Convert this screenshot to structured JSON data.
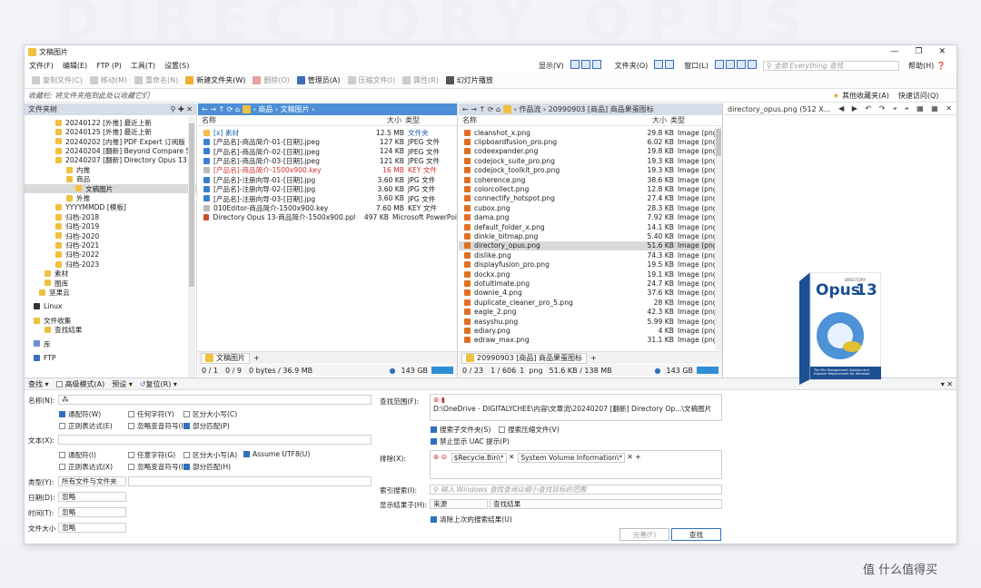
{
  "bg_text": "DIRECTORY OPUS",
  "window_title": "文稿图片",
  "menu": [
    "文件(F)",
    "编辑(E)",
    "FTP (P)",
    "工具(T)",
    "设置(S)"
  ],
  "menu_right": {
    "display": "显示(V)",
    "folder": "文件夹(O)",
    "window": "窗口(L)",
    "search_placeholder": "全局 Everything 查找",
    "help": "帮助(H)"
  },
  "toolbar": [
    "复制文件(C)",
    "移动(M)",
    "重命名(N)",
    "新建文件夹(W)",
    "删除(D)",
    "管理员(A)",
    "压缩文件(I)",
    "属性(R)",
    "幻灯片播放"
  ],
  "favbar": {
    "hint": "收藏栏: 将文件夹拖到此处以收藏它们",
    "others": "其他收藏夹(A)",
    "quick": "快速访问(Q)"
  },
  "tree": {
    "header": "文件夹树",
    "items": [
      "20240122 [外推] 最近上新",
      "20240125 [外推] 最近上新",
      "20240202 [内推] PDF Expert 订阅版",
      "20240204 [翻新] Beyond Compare 5",
      "20240207 [翻新] Directory Opus 13",
      "内推",
      "商品",
      "文稿图片",
      "外推",
      "YYYYMMDD [模板]",
      "归档-2018",
      "归档-2019",
      "归档-2020",
      "归档-2021",
      "归档-2022",
      "归档-2023",
      "素材",
      "图库",
      "坚果云",
      "Linux",
      "文件收集",
      "查找结果",
      "库",
      "FTP"
    ]
  },
  "left": {
    "path": [
      "商品",
      "文稿图片"
    ],
    "cols": [
      "名称",
      "大小",
      "类型"
    ],
    "files": [
      [
        "[x] 素材",
        "12.5 MB",
        "文件夹"
      ],
      [
        "[产品名]-商品简介-01-[日期].jpeg",
        "127 KB",
        "JPEG 文件"
      ],
      [
        "[产品名]-商品简介-02-[日期].jpeg",
        "124 KB",
        "JPEG 文件"
      ],
      [
        "[产品名]-商品简介-03-[日期].jpeg",
        "121 KB",
        "JPEG 文件"
      ],
      [
        "[产品名]-商品简介-1500x900.key",
        "16 MB",
        "KEY 文件"
      ],
      [
        "[产品名]-注册向导-01-[日期].jpg",
        "3.60 KB",
        "JPG 文件"
      ],
      [
        "[产品名]-注册向导-02-[日期].jpg",
        "3.60 KB",
        "JPG 文件"
      ],
      [
        "[产品名]-注册向导-03-[日期].jpg",
        "3.60 KB",
        "JPG 文件"
      ],
      [
        "010Editor-商品简介-1500x900.key",
        "7.60 MB",
        "KEY 文件"
      ],
      [
        "Directory Opus 13-商品简介-1500x900.pptx",
        "497 KB",
        "Microsoft PowerPoi"
      ]
    ],
    "tab": "文稿图片",
    "status": [
      "0 / 1",
      "0 / 9",
      "0 bytes / 36.9 MB",
      "143 GB"
    ]
  },
  "right": {
    "path": [
      "作品流",
      "20990903 [商品] 商品果蛋图标"
    ],
    "cols": [
      "名称",
      "大小",
      "类型"
    ],
    "files": [
      [
        "cleanshot_x.png",
        "29.8 KB",
        "Image (png"
      ],
      [
        "clipboardfusion_pro.png",
        "6.02 KB",
        "Image (png"
      ],
      [
        "codeexpander.png",
        "19.8 KB",
        "Image (png"
      ],
      [
        "codejock_suite_pro.png",
        "19.3 KB",
        "Image (png"
      ],
      [
        "codejock_toolkit_pro.png",
        "19.3 KB",
        "Image (png"
      ],
      [
        "coherence.png",
        "38.6 KB",
        "Image (png"
      ],
      [
        "colorcollect.png",
        "12.8 KB",
        "Image (png"
      ],
      [
        "connectify_hotspot.png",
        "27.4 KB",
        "Image (png"
      ],
      [
        "cubox.png",
        "28.3 KB",
        "Image (png"
      ],
      [
        "dama.png",
        "7.92 KB",
        "Image (png"
      ],
      [
        "default_folder_x.png",
        "14.1 KB",
        "Image (png"
      ],
      [
        "dinkie_bitmap.png",
        "5.40 KB",
        "Image (png"
      ],
      [
        "directory_opus.png",
        "51.6 KB",
        "Image (png"
      ],
      [
        "dislike.png",
        "74.3 KB",
        "Image (png"
      ],
      [
        "displayfusion_pro.png",
        "19.5 KB",
        "Image (png"
      ],
      [
        "dockx.png",
        "19.1 KB",
        "Image (png"
      ],
      [
        "dotultimate.png",
        "24.7 KB",
        "Image (png"
      ],
      [
        "downie_4.png",
        "37.6 KB",
        "Image (png"
      ],
      [
        "duplicate_cleaner_pro_5.png",
        "28 KB",
        "Image (png"
      ],
      [
        "eagle_2.png",
        "42.3 KB",
        "Image (png"
      ],
      [
        "easyshu.png",
        "5.99 KB",
        "Image (png"
      ],
      [
        "ediary.png",
        "4 KB",
        "Image (png"
      ],
      [
        "edraw_max.png",
        "31.1 KB",
        "Image (png"
      ]
    ],
    "tab": "20990903 [商品] 商品果蛋图标",
    "status": [
      "0 / 23",
      "1 / 606",
      "1",
      "png",
      "51.6 KB / 138 MB",
      "143 GB"
    ]
  },
  "viewer": {
    "title": "directory_opus.png (512 X...",
    "box_brand": "DIRECTORY",
    "box_name": "Opus",
    "box_ver": "13",
    "box_tagline": "The File Management Solution and Explorer Replacement for Windows"
  },
  "find": {
    "tabs": [
      "查找",
      "高级模式(A)",
      "预设",
      "复位(R)"
    ],
    "name_label": "名称(N):",
    "name_value": "⁂",
    "opts1": [
      "通配符(W)",
      "任何字符(Y)",
      "区分大小写(C)",
      "正则表达式(E)",
      "忽略变音符号(I)",
      "部分匹配(P)"
    ],
    "text_label": "文本(X):",
    "opts2": [
      "通配符(I)",
      "任意字符(G)",
      "区分大小写(A)",
      "Assume UTF8(U)",
      "正则表达式(X)",
      "忽略变音符号(I)",
      "部分匹配(H)"
    ],
    "type_label": "类型(Y):",
    "type_value": "所有文件与文件夹",
    "date_label": "日期(D):",
    "date_value": "忽略",
    "time_label": "时间(T):",
    "time_value": "忽略",
    "size_label": "文件大小",
    "size_value": "忽略",
    "scope_label": "查找范围(F):",
    "scope_path": "D:\\OneDrive - DIGITALYCHEE\\内容\\文章流\\20240207 [翻新] Directory Op...\\文稿图片",
    "scope_opts": [
      "搜索子文件夹(S)",
      "搜索压缩文件(V)",
      "禁止显示 UAC 提示(P)"
    ],
    "exclude_label": "排除(X):",
    "exclude_items": [
      "$Recycle.Bin\\*",
      "System Volume Information\\*"
    ],
    "index_label": "索引搜索(I):",
    "index_placeholder": "输入 Windows 查找查询以缩小查找目标的范围",
    "show_label": "显示结果于(H):",
    "show_value": "来源",
    "show_value2": "查找结果",
    "clear_label": "清除上次的搜索结果(U)",
    "btn_done": "完善(F)",
    "btn_search": "查找"
  },
  "watermark": "值 什么值得买"
}
